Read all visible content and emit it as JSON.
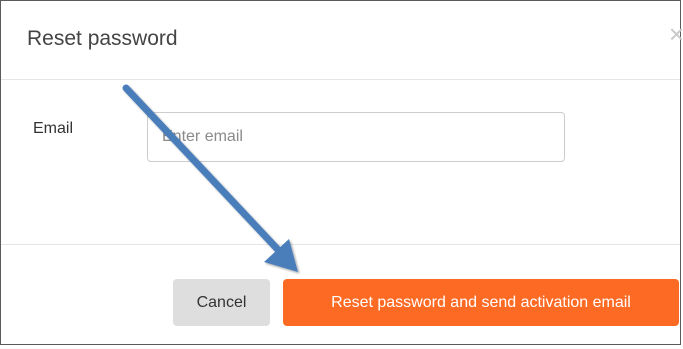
{
  "modal": {
    "title": "Reset password",
    "close_icon": "close-icon",
    "close_symbol": "×"
  },
  "form": {
    "email_label": "Email",
    "email_placeholder": "Enter email",
    "email_value": ""
  },
  "footer": {
    "cancel_label": "Cancel",
    "submit_label": "Reset password and send activation email"
  },
  "colors": {
    "primary": "#fd6a24",
    "cancel_bg": "#dedede",
    "annotation_arrow": "#4a7ebb"
  },
  "annotation": {
    "icon": "arrow-icon"
  }
}
